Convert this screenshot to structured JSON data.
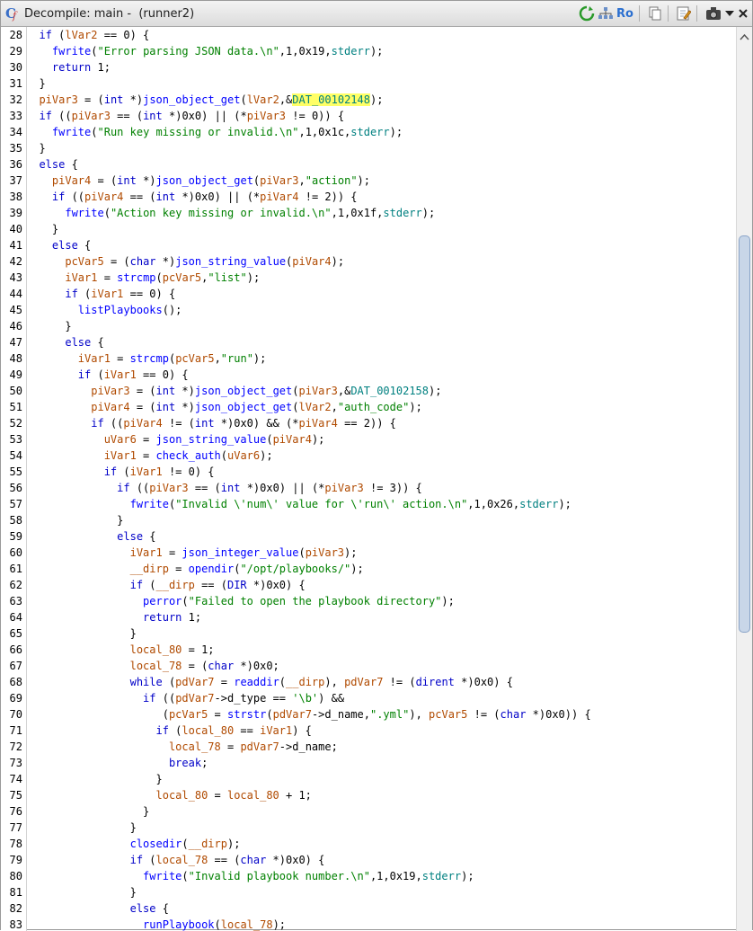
{
  "window": {
    "title": "Decompile: main -  (runner2)"
  },
  "toolbar": {
    "ro_label": "Ro"
  },
  "colors": {
    "keyword": "#0000c8",
    "function": "#0000ff",
    "string": "#008000",
    "variable": "#b04a00",
    "global": "#008080",
    "highlight": "#ffff66"
  },
  "code": {
    "lines": [
      {
        "n": "28",
        "t": "  if (lVar2 == 0) {"
      },
      {
        "n": "29",
        "t": "    fwrite(\"Error parsing JSON data.\\n\",1,0x19,stderr);"
      },
      {
        "n": "30",
        "t": "    return 1;"
      },
      {
        "n": "31",
        "t": "  }"
      },
      {
        "n": "32",
        "t": "  piVar3 = (int *)json_object_get(lVar2,&DAT_00102148);"
      },
      {
        "n": "33",
        "t": "  if ((piVar3 == (int *)0x0) || (*piVar3 != 0)) {"
      },
      {
        "n": "34",
        "t": "    fwrite(\"Run key missing or invalid.\\n\",1,0x1c,stderr);"
      },
      {
        "n": "35",
        "t": "  }"
      },
      {
        "n": "36",
        "t": "  else {"
      },
      {
        "n": "37",
        "t": "    piVar4 = (int *)json_object_get(piVar3,\"action\");"
      },
      {
        "n": "38",
        "t": "    if ((piVar4 == (int *)0x0) || (*piVar4 != 2)) {"
      },
      {
        "n": "39",
        "t": "      fwrite(\"Action key missing or invalid.\\n\",1,0x1f,stderr);"
      },
      {
        "n": "40",
        "t": "    }"
      },
      {
        "n": "41",
        "t": "    else {"
      },
      {
        "n": "42",
        "t": "      pcVar5 = (char *)json_string_value(piVar4);"
      },
      {
        "n": "43",
        "t": "      iVar1 = strcmp(pcVar5,\"list\");"
      },
      {
        "n": "44",
        "t": "      if (iVar1 == 0) {"
      },
      {
        "n": "45",
        "t": "        listPlaybooks();"
      },
      {
        "n": "46",
        "t": "      }"
      },
      {
        "n": "47",
        "t": "      else {"
      },
      {
        "n": "48",
        "t": "        iVar1 = strcmp(pcVar5,\"run\");"
      },
      {
        "n": "49",
        "t": "        if (iVar1 == 0) {"
      },
      {
        "n": "50",
        "t": "          piVar3 = (int *)json_object_get(piVar3,&DAT_00102158);"
      },
      {
        "n": "51",
        "t": "          piVar4 = (int *)json_object_get(lVar2,\"auth_code\");"
      },
      {
        "n": "52",
        "t": "          if ((piVar4 != (int *)0x0) && (*piVar4 == 2)) {"
      },
      {
        "n": "53",
        "t": "            uVar6 = json_string_value(piVar4);"
      },
      {
        "n": "54",
        "t": "            iVar1 = check_auth(uVar6);"
      },
      {
        "n": "55",
        "t": "            if (iVar1 != 0) {"
      },
      {
        "n": "56",
        "t": "              if ((piVar3 == (int *)0x0) || (*piVar3 != 3)) {"
      },
      {
        "n": "57",
        "t": "                fwrite(\"Invalid \\'num\\' value for \\'run\\' action.\\n\",1,0x26,stderr);"
      },
      {
        "n": "58",
        "t": "              }"
      },
      {
        "n": "59",
        "t": "              else {"
      },
      {
        "n": "60",
        "t": "                iVar1 = json_integer_value(piVar3);"
      },
      {
        "n": "61",
        "t": "                __dirp = opendir(\"/opt/playbooks/\");"
      },
      {
        "n": "62",
        "t": "                if (__dirp == (DIR *)0x0) {"
      },
      {
        "n": "63",
        "t": "                  perror(\"Failed to open the playbook directory\");"
      },
      {
        "n": "64",
        "t": "                  return 1;"
      },
      {
        "n": "65",
        "t": "                }"
      },
      {
        "n": "66",
        "t": "                local_80 = 1;"
      },
      {
        "n": "67",
        "t": "                local_78 = (char *)0x0;"
      },
      {
        "n": "68",
        "t": "                while (pdVar7 = readdir(__dirp), pdVar7 != (dirent *)0x0) {"
      },
      {
        "n": "69",
        "t": "                  if ((pdVar7->d_type == '\\b') &&"
      },
      {
        "n": "70",
        "t": "                     (pcVar5 = strstr(pdVar7->d_name,\".yml\"), pcVar5 != (char *)0x0)) {"
      },
      {
        "n": "71",
        "t": "                    if (local_80 == iVar1) {"
      },
      {
        "n": "72",
        "t": "                      local_78 = pdVar7->d_name;"
      },
      {
        "n": "73",
        "t": "                      break;"
      },
      {
        "n": "74",
        "t": "                    }"
      },
      {
        "n": "75",
        "t": "                    local_80 = local_80 + 1;"
      },
      {
        "n": "76",
        "t": "                  }"
      },
      {
        "n": "77",
        "t": "                }"
      },
      {
        "n": "78",
        "t": "                closedir(__dirp);"
      },
      {
        "n": "79",
        "t": "                if (local_78 == (char *)0x0) {"
      },
      {
        "n": "80",
        "t": "                  fwrite(\"Invalid playbook number.\\n\",1,0x19,stderr);"
      },
      {
        "n": "81",
        "t": "                }"
      },
      {
        "n": "82",
        "t": "                else {"
      },
      {
        "n": "83",
        "t": "                  runPlaybook(local_78);"
      }
    ]
  }
}
